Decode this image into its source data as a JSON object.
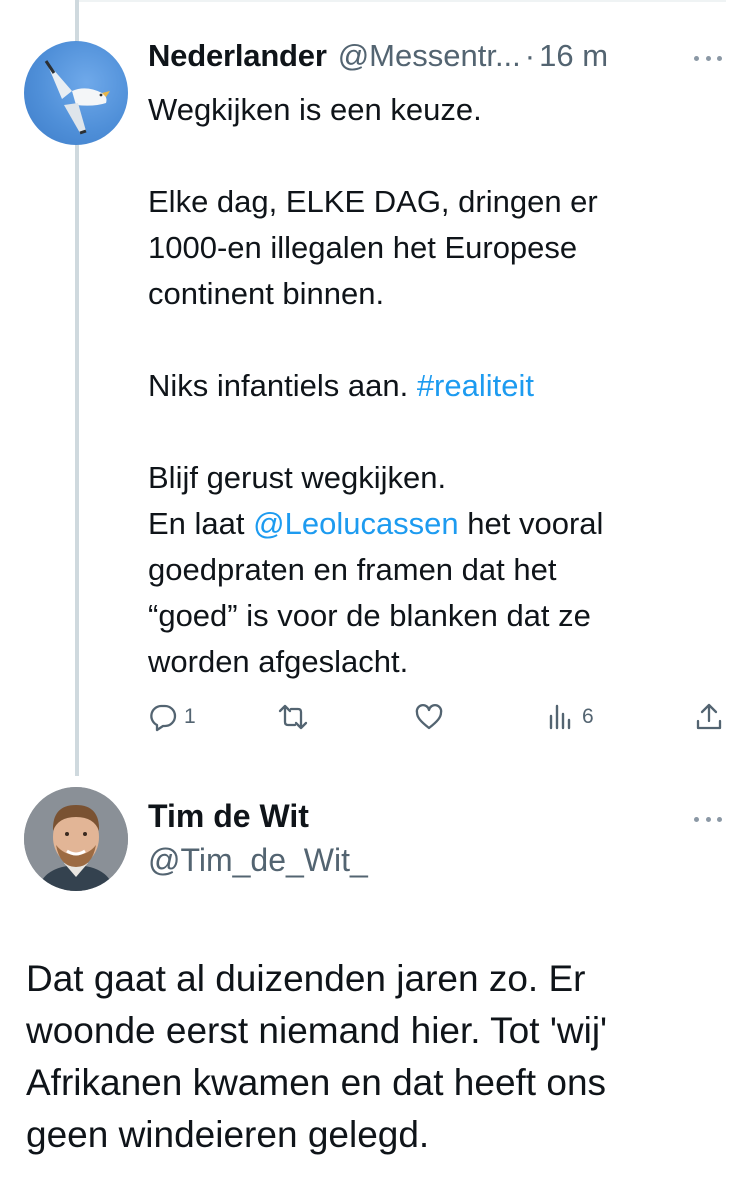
{
  "thread_tweet": {
    "author_name": "Nederlander",
    "author_handle": "@Messentr...",
    "separator": "·",
    "time": "16 m",
    "text": {
      "line1": "Wegkijken is een keuze.",
      "line2": "Elke dag, ELKE DAG, dringen er",
      "line3": "1000-en illegalen het Europese",
      "line4": "continent binnen.",
      "line5_prefix": "Niks infantiels aan. ",
      "hashtag": "#realiteit",
      "line6": "Blijf gerust wegkijken.",
      "line7_prefix": "En laat ",
      "mention": "@Leolucassen",
      "line7_suffix": " het vooral",
      "line8": "goedpraten en framen dat het",
      "line9": "“goed” is voor de blanken dat ze",
      "line10": "worden afgeslacht."
    },
    "actions": {
      "reply_count": "1",
      "repost_count": "",
      "like_count": "",
      "views_count": "6"
    }
  },
  "reply_tweet": {
    "author_name": "Tim de Wit",
    "author_handle": "@Tim_de_Wit_",
    "text": {
      "line1": "Dat gaat al duizenden jaren zo. Er",
      "line2": "woonde eerst niemand hier. Tot 'wij'",
      "line3": "Afrikanen kwamen en dat heeft ons",
      "line4": "geen windeieren gelegd."
    }
  },
  "icons": {
    "more": "more-horizontal-icon",
    "reply": "reply-icon",
    "repost": "repost-icon",
    "like": "heart-icon",
    "views": "views-icon",
    "share": "share-icon"
  },
  "colors": {
    "link": "#1d9bf0",
    "secondary_text": "#536471",
    "thread_line": "#cfd9de"
  }
}
